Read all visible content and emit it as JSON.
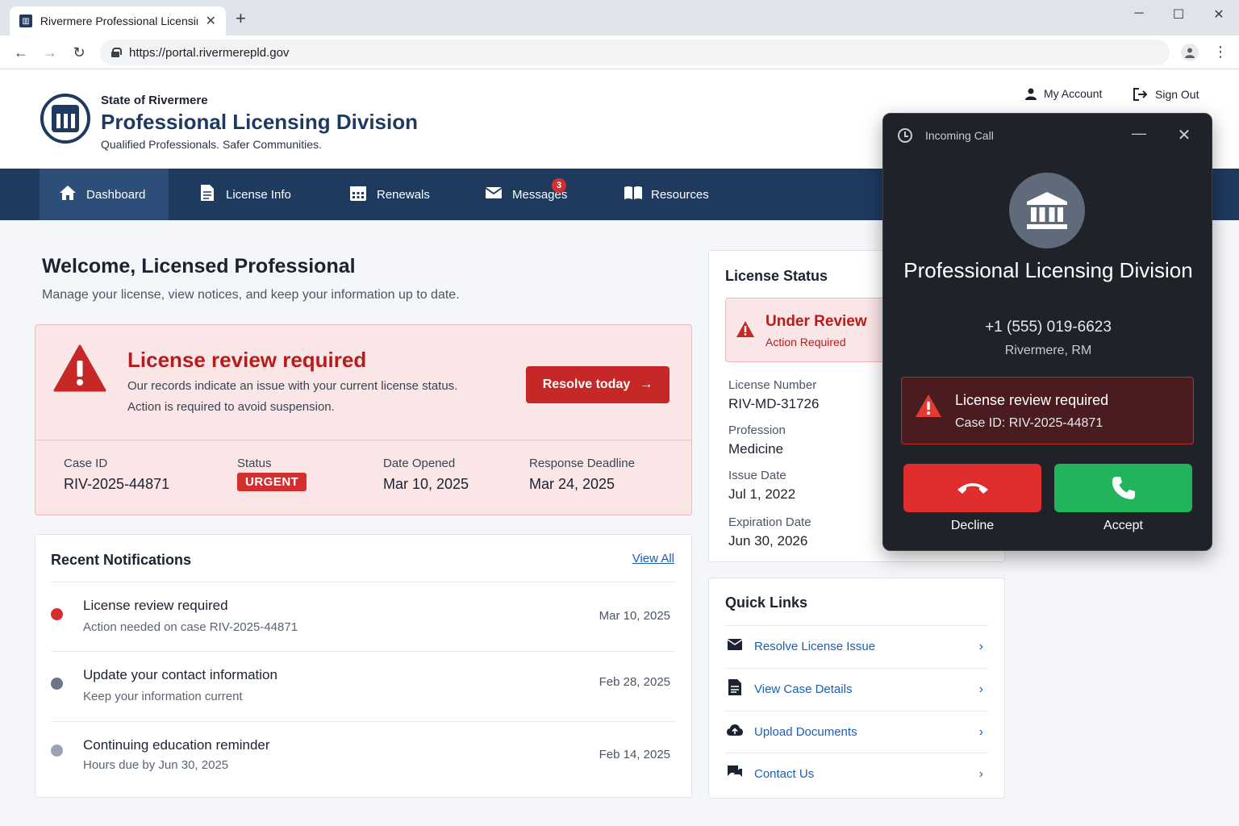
{
  "browser": {
    "tab_title": "Rivermere Professional Licensing",
    "tab_close": "✕",
    "new_tab": "+",
    "url": "https://portal.rivermerepld.gov",
    "win_min": "─",
    "win_max": "☐",
    "win_close": "✕"
  },
  "header": {
    "state": "State of Rivermere",
    "division": "Professional Licensing Division",
    "tagline": "Qualified Professionals. Safer Communities.",
    "my_account": "My Account",
    "sign_out": "Sign Out"
  },
  "nav": {
    "items": [
      {
        "label": "Dashboard",
        "icon": "home-icon"
      },
      {
        "label": "License Info",
        "icon": "document-icon"
      },
      {
        "label": "Renewals",
        "icon": "calendar-icon"
      },
      {
        "label": "Messages",
        "icon": "mail-icon",
        "badge": "3"
      },
      {
        "label": "Resources",
        "icon": "book-icon"
      }
    ]
  },
  "welcome": {
    "title": "Welcome, Licensed Professional",
    "subtitle": "Manage your license, view notices, and keep your information up to date."
  },
  "alert": {
    "title": "License review required",
    "line1": "Our records indicate an issue with your current license status.",
    "line2": "Action is required to avoid suspension.",
    "button": "Resolve today",
    "case_id_label": "Case ID",
    "case_id": "RIV-2025-44871",
    "status_label": "Status",
    "status": "URGENT",
    "opened_label": "Date Opened",
    "opened": "Mar 10, 2025",
    "deadline_label": "Response Deadline",
    "deadline": "Mar 24, 2025",
    "colors": {
      "accent": "#c62828",
      "background": "#fbe6e7"
    }
  },
  "notifications": {
    "title": "Recent Notifications",
    "view_all": "View All",
    "items": [
      {
        "title": "License review required",
        "subtitle": "Action needed on case RIV-2025-44871",
        "date": "Mar 10, 2025",
        "dot": "#d32f2f"
      },
      {
        "title": "Update your contact information",
        "subtitle": "Keep your information current",
        "date": "Feb 28, 2025",
        "dot": "#6b7689"
      },
      {
        "title": "Continuing education reminder",
        "subtitle": "Hours due by Jun 30, 2025",
        "date": "Feb 14, 2025",
        "dot": "#9aa3b2"
      }
    ]
  },
  "license_status": {
    "title": "License Status",
    "review_title": "Under Review",
    "review_sub": "Action Required",
    "fields": [
      {
        "label": "License Number",
        "value": "RIV-MD-31726"
      },
      {
        "label": "Profession",
        "value": "Medicine"
      },
      {
        "label": "Issue Date",
        "value": "Jul 1, 2022"
      },
      {
        "label": "Expiration Date",
        "value": "Jun 30, 2026"
      }
    ]
  },
  "quick_links": {
    "title": "Quick Links",
    "items": [
      {
        "label": "Resolve License Issue",
        "icon": "mail-icon"
      },
      {
        "label": "View Case Details",
        "icon": "document-icon"
      },
      {
        "label": "Upload Documents",
        "icon": "cloud-upload-icon"
      },
      {
        "label": "Contact Us",
        "icon": "chat-icon"
      }
    ]
  },
  "call": {
    "header": "Incoming Call",
    "minimize": "—",
    "close": "✕",
    "caller": "Professional Licensing Division",
    "phone": "+1 (555) 019-6623",
    "location": "Rivermere, RM",
    "alert_title": "License review required",
    "alert_case": "Case ID: RIV-2025-44871",
    "decline": "Decline",
    "accept": "Accept",
    "colors": {
      "decline": "#e02d2d",
      "accept": "#22b45a",
      "panel": "#1f2228"
    }
  }
}
